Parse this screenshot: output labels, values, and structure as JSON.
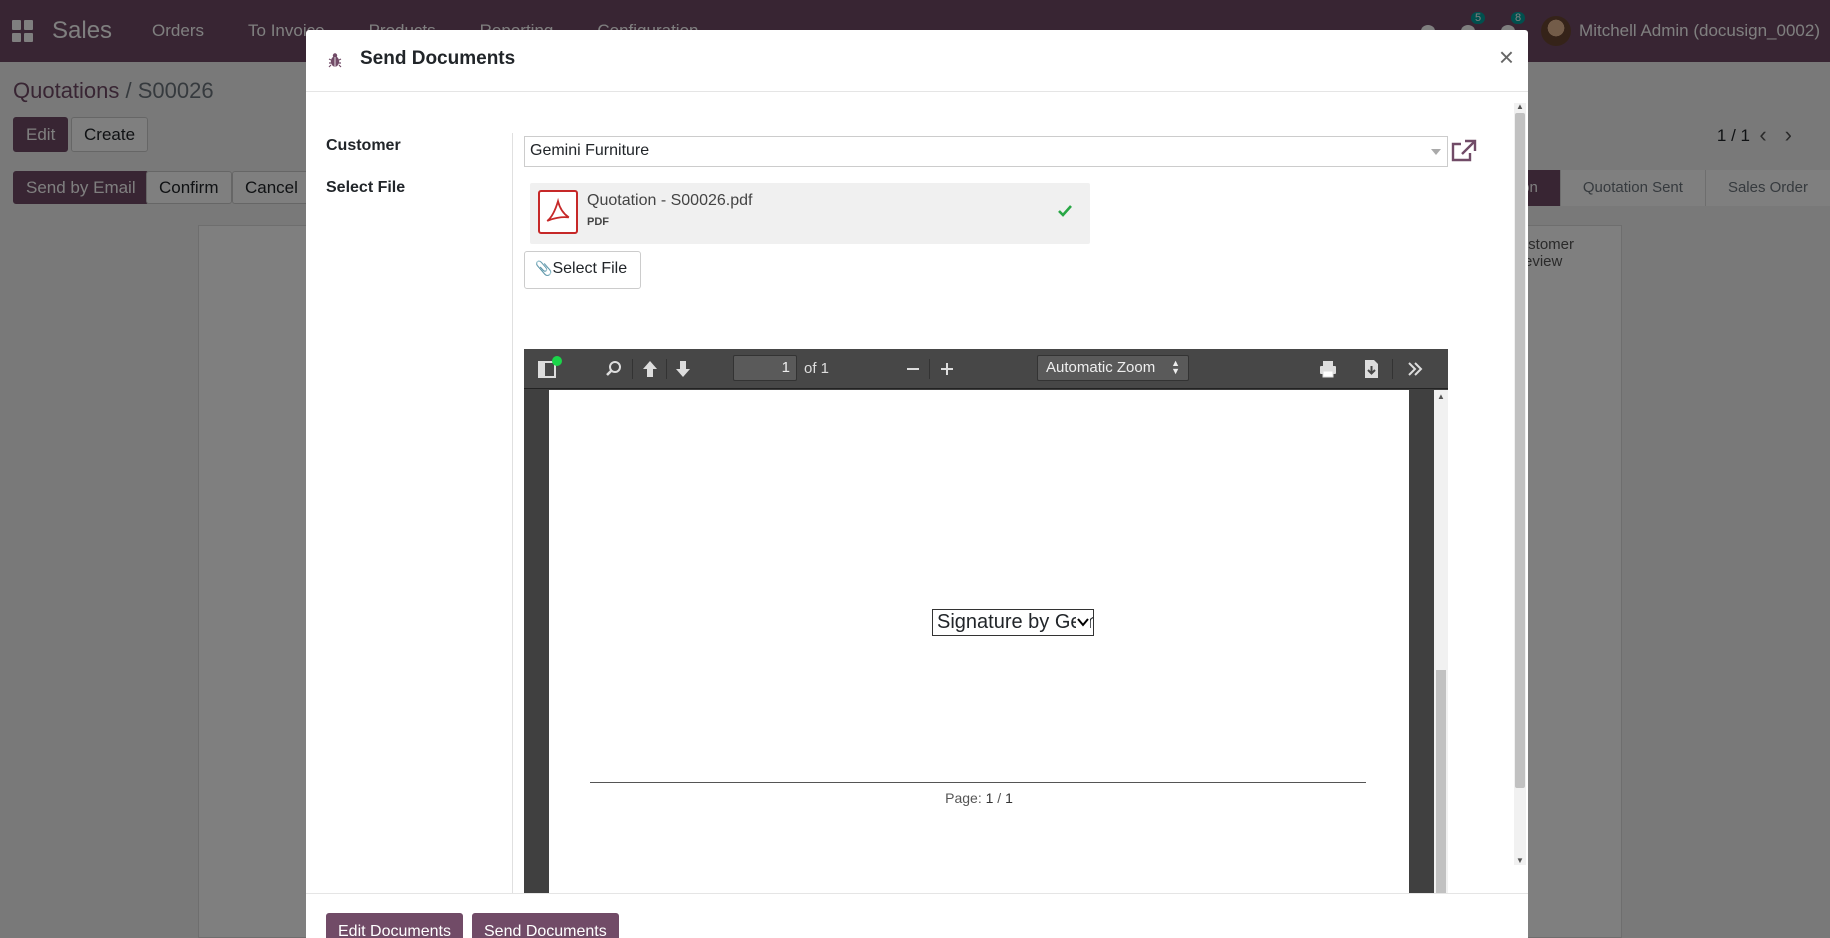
{
  "navbar": {
    "app_name": "Sales",
    "menu": [
      "Orders",
      "To Invoice",
      "Products",
      "Reporting",
      "Configuration"
    ],
    "activity_count": "5",
    "messages_count": "8",
    "user": "Mitchell Admin (docusign_0002)"
  },
  "background": {
    "breadcrumb_parent": "Quotations",
    "breadcrumb_sep": " / ",
    "breadcrumb_current": "S00026",
    "edit_label": "Edit",
    "create_label": "Create",
    "pager": "1 / 1",
    "send_email_label": "Send by Email",
    "confirm_label": "Confirm",
    "cancel_label": "Cancel",
    "status_steps": [
      "Quotation",
      "Quotation Sent",
      "Sales Order"
    ],
    "customer_preview": "Customer Preview"
  },
  "modal": {
    "title": "Send Documents",
    "close_glyph": "×",
    "customer_label": "Customer",
    "customer_value": "Gemini Furniture",
    "select_file_label": "Select File",
    "file_name": "Quotation - S00026.pdf",
    "file_type": "PDF",
    "select_file_button": "Select File",
    "pdf_viewer": {
      "page_current": "1",
      "page_of": "of 1",
      "zoom": "Automatic Zoom",
      "signature_field": "Signature by Gemini Furniture",
      "footer_prefix": "Page: ",
      "footer_page": "1",
      "footer_sep": " / ",
      "footer_total": "1"
    },
    "edit_documents_button": "Edit Documents",
    "send_documents_button": "Send Documents"
  },
  "colors": {
    "primary": "#714b67",
    "pdf_icon": "#c62828",
    "check": "#28a745"
  }
}
